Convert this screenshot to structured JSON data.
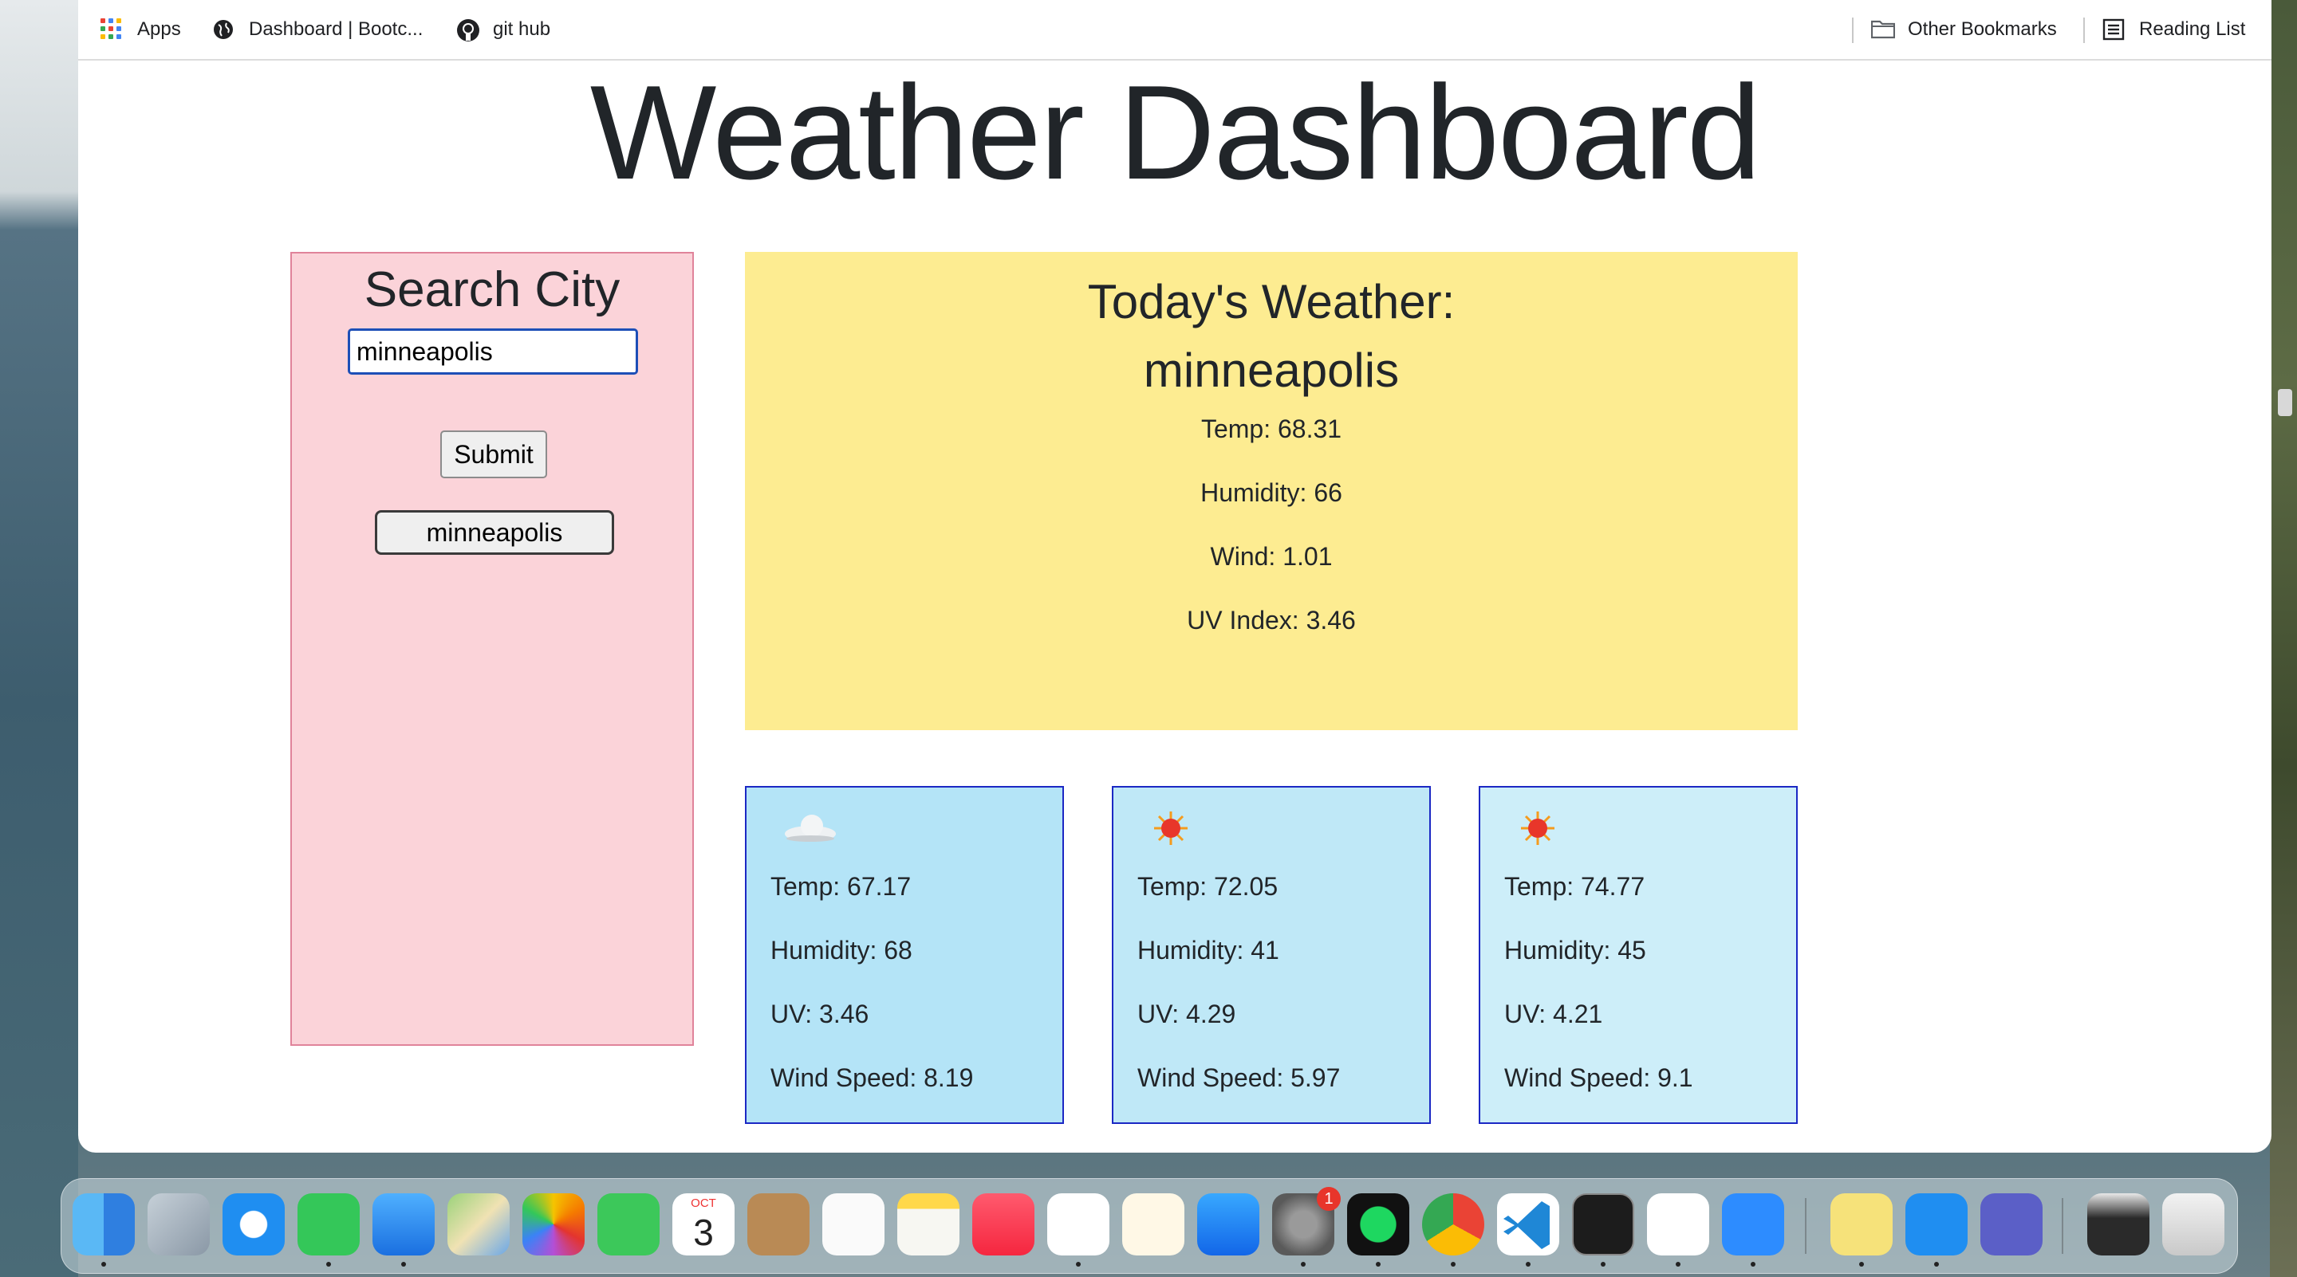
{
  "bookmarks_bar": {
    "apps_label": "Apps",
    "dashboard_label": "Dashboard | Bootc...",
    "github_label": "git hub",
    "other_bookmarks_label": "Other Bookmarks",
    "reading_list_label": "Reading List"
  },
  "page": {
    "title": "Weather Dashboard"
  },
  "search": {
    "heading": "Search City",
    "input_value": "minneapolis",
    "submit_label": "Submit",
    "history": [
      "minneapolis"
    ]
  },
  "today": {
    "heading": "Today's Weather:",
    "city": "minneapolis",
    "temp": "Temp: 68.31",
    "humidity": "Humidity: 66",
    "wind": "Wind: 1.01",
    "uv": "UV Index: 3.46"
  },
  "forecast": [
    {
      "icon": "cloud-icon",
      "temp": "Temp: 67.17",
      "humidity": "Humidity: 68",
      "uv": "UV: 3.46",
      "wind": "Wind Speed: 8.19",
      "bg": "#b4e4f7"
    },
    {
      "icon": "sun-icon",
      "temp": "Temp: 72.05",
      "humidity": "Humidity: 41",
      "uv": "UV: 4.29",
      "wind": "Wind Speed: 5.97",
      "bg": "#bfe8f7"
    },
    {
      "icon": "sun-icon",
      "temp": "Temp: 74.77",
      "humidity": "Humidity: 45",
      "uv": "UV: 4.21",
      "wind": "Wind Speed: 9.1",
      "bg": "#cdeef9"
    }
  ],
  "dock": {
    "calendar_month": "OCT",
    "calendar_day": "3",
    "system_prefs_badge": "1"
  },
  "colors": {
    "search_panel_bg": "#fbd3d9",
    "today_bg": "#fdec91",
    "card_border": "#1b28c4"
  }
}
